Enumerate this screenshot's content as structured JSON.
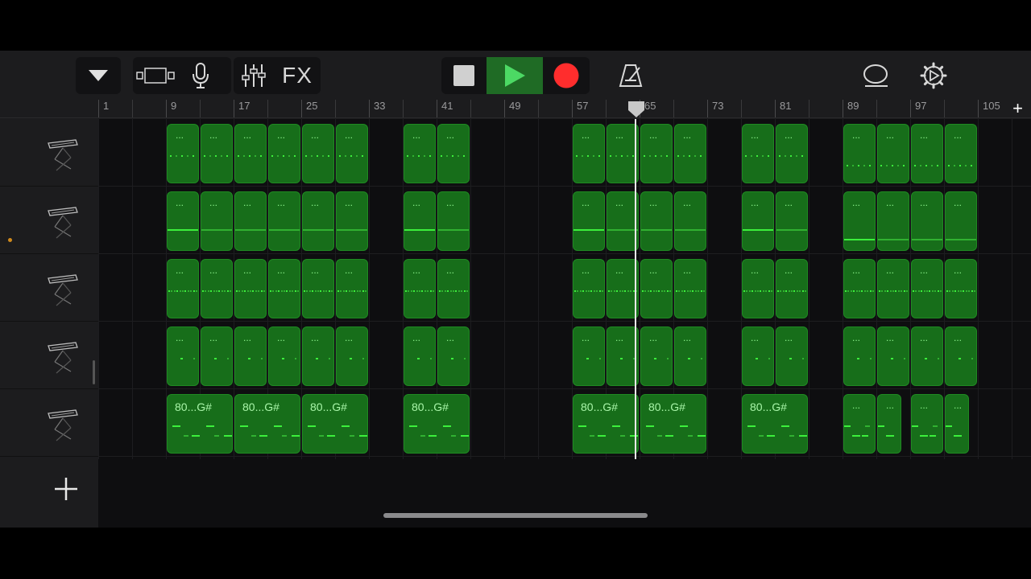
{
  "toolbar": {
    "browser_icon": "triangle-down-icon",
    "tracks_view_icon": "tracks-view-icon",
    "mic_icon": "microphone-icon",
    "mixer_icon": "mixer-sliders-icon",
    "fx_label": "FX",
    "stop_icon": "stop-icon",
    "play_icon": "play-icon",
    "record_icon": "record-icon",
    "metronome_icon": "metronome-icon",
    "loop_icon": "loop-icon",
    "settings_icon": "gear-icon"
  },
  "ruler": {
    "bar_numbers": [
      "1",
      "9",
      "17",
      "25",
      "33",
      "41",
      "49",
      "57",
      "65",
      "73",
      "81",
      "89",
      "97",
      "105"
    ],
    "add_section_label": "+"
  },
  "tracks": [
    {
      "name": "keyboard-track-1",
      "instrument_icon": "keyboard-stand-icon"
    },
    {
      "name": "keyboard-track-2",
      "instrument_icon": "keyboard-stand-icon"
    },
    {
      "name": "keyboard-track-3",
      "instrument_icon": "keyboard-stand-icon"
    },
    {
      "name": "keyboard-track-4",
      "instrument_icon": "keyboard-stand-icon"
    },
    {
      "name": "keyboard-track-5",
      "instrument_icon": "keyboard-stand-icon"
    }
  ],
  "region_dots_label": "...",
  "chord_region_label": "80...G#",
  "add_track_label": "+",
  "colors": {
    "region_fill": "#176e1a",
    "note": "#3cf03c",
    "play": "#4cd964",
    "record": "#ff2d2d"
  }
}
